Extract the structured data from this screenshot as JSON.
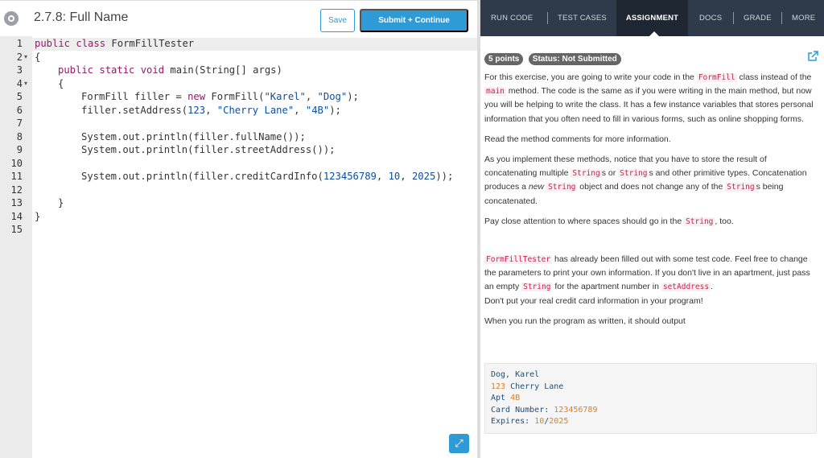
{
  "header": {
    "title": "2.7.8: Full Name",
    "save_label": "Save",
    "submit_label": "Submit + Continue"
  },
  "editor": {
    "line_numbers": [
      "1",
      "2",
      "3",
      "4",
      "5",
      "6",
      "7",
      "8",
      "9",
      "10",
      "11",
      "12",
      "13",
      "14",
      "15"
    ],
    "lines": {
      "l1_kw": "public class",
      "l1_rest": " FormFillTester",
      "l2": "{",
      "l3_kw": "public static void",
      "l3_rest": " main(String[] args)",
      "l4": "{",
      "l5_a": "FormFill filler = ",
      "l5_kw": "new",
      "l5_b": " FormFill(",
      "l5_s1": "\"Karel\"",
      "l5_c": ", ",
      "l5_s2": "\"Dog\"",
      "l5_d": ");",
      "l6_a": "filler.setAddress(",
      "l6_n": "123",
      "l6_b": ", ",
      "l6_s1": "\"Cherry Lane\"",
      "l6_c": ", ",
      "l6_s2": "\"4B\"",
      "l6_d": ");",
      "l8": "System.out.println(filler.fullName());",
      "l9": "System.out.println(filler.streetAddress());",
      "l11_a": "System.out.println(filler.creditCardInfo(",
      "l11_n1": "123456789",
      "l11_b": ", ",
      "l11_n2": "10",
      "l11_c": ", ",
      "l11_n3": "2025",
      "l11_d": "));",
      "l13": "}",
      "l14": "}"
    }
  },
  "tabs": {
    "run_code": "RUN CODE",
    "test_cases": "TEST CASES",
    "assignment": "ASSIGNMENT",
    "docs": "DOCS",
    "grade": "GRADE",
    "more": "MORE"
  },
  "assignment": {
    "points_badge": "5 points",
    "status_badge": "Status: Not Submitted",
    "p1_a": "For this exercise, you are going to write your code in the ",
    "p1_code1": "FormFill",
    "p1_b": " class instead of the ",
    "p1_code2": "main",
    "p1_c": " method. The code is the same as if you were writing in the main method, but now you will be helping to write the class. It has a few instance variables that stores personal information that you often need to fill in various forms, such as online shopping forms.",
    "p2": "Read the method comments for more information.",
    "p3_a": "As you implement these methods, notice that you have to store the result of concatenating multiple ",
    "p3_code1": "String",
    "p3_b": "s or ",
    "p3_code2": "String",
    "p3_c": "s and other primitive types. Concatenation produces a ",
    "p3_em": "new",
    "p3_d": " ",
    "p3_code3": "String",
    "p3_e": " object and does not change any of the ",
    "p3_code4": "String",
    "p3_f": "s being concatenated.",
    "p4_a": "Pay close attention to where spaces should go in the ",
    "p4_code": "String",
    "p4_b": ", too.",
    "p5_code1": "FormFillTester",
    "p5_a": " has already been filled out with some test code. Feel free to change the parameters to print your own information. If you don't live in an apartment, just pass an empty ",
    "p5_code2": "String",
    "p5_b": " for the apartment number in ",
    "p5_code3": "setAddress",
    "p5_c": ".",
    "p6": "Don't put your real credit card information in your program!",
    "p7": "When you run the program as written, it should output",
    "output": {
      "line1": "Dog, Karel",
      "line2_num": "123",
      "line2_text": " Cherry Lane",
      "line3_text": "Apt ",
      "line3_num": "4B",
      "line4_text": "Card Number: ",
      "line4_num": "123456789",
      "line5_text": "Expires: ",
      "line5_num1": "10",
      "line5_sep": "/",
      "line5_num2": "2025"
    }
  },
  "colors": {
    "accent": "#2e9bd6",
    "tab_bar": "#2f3b4a",
    "active_tab": "#1f2832",
    "keyword": "#931a68",
    "string": "#0b4fa0",
    "inline_code": "#c7254e"
  }
}
